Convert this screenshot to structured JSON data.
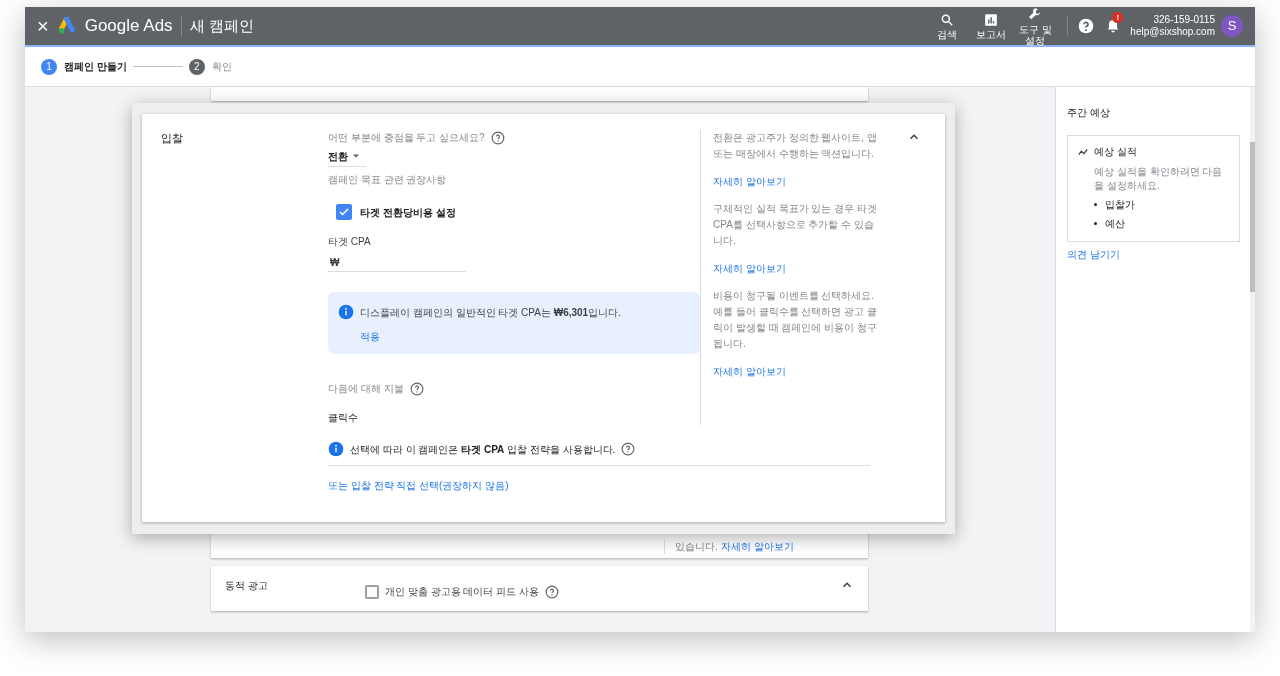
{
  "header": {
    "close": "×",
    "brand": "Google Ads",
    "page_title": "새 캠페인",
    "tools": [
      {
        "kind": "search",
        "label": "검색"
      },
      {
        "kind": "reports",
        "label": "보고서"
      },
      {
        "kind": "tools",
        "label": "도구 및 설정"
      }
    ],
    "account": {
      "phone": "326-159-0115",
      "email": "help@sixshop.com",
      "avatar": "S"
    },
    "notification_badge": "!"
  },
  "steps": [
    {
      "number": "1",
      "label": "캠페인 만들기",
      "selected": true
    },
    {
      "number": "2",
      "label": "확인",
      "selected": false
    }
  ],
  "bidding": {
    "title": "입찰",
    "question": "어떤 부분에 중점을 두고 싶으세요?",
    "focus": "전환",
    "recommendation": "캠페인 목표 관련 권장사항",
    "target_cpa_checkbox": {
      "label": "타겟 전환당비용 설정",
      "checked": true
    },
    "target_cpa_label": "타겟 CPA",
    "currency": "₩",
    "info": {
      "text": "디스플레이 캠페인의 일반적인 타겟 CPA는 **₩6,301**입니다.",
      "action": "적용"
    },
    "pay_for_label": "다음에 대해 지불",
    "pay_for": "클릭수",
    "strategy_note": "선택에 따라 이 캠페인은 **타겟 CPA** 입찰 전략을 사용합니다.",
    "manual_link": "또는 입찰 전략 직접 선택(권장하지 않음)",
    "help": [
      {
        "text": "전환은 광고주가 정의한 웹사이트, 앱 또는 매장에서 수행하는 액션입니다.",
        "link": "자세히 알아보기"
      },
      {
        "text": "구체적인 실적 목표가 있는 경우 타겟 CPA를 선택사항으로 추가할 수 있습니다.",
        "link": "자세히 알아보기"
      },
      {
        "text": "비용이 청구될 이벤트를 선택하세요. 예를 들어 클릭수를 선택하면 광고 클릭이 발생할 때 캠페인에 비용이 청구됩니다.",
        "link": "자세히 알아보기"
      }
    ]
  },
  "background_card": {
    "text": "있습니다.",
    "link": "자세히 알아보기"
  },
  "dynamic_ads": {
    "title": "동적 광고",
    "checkbox": {
      "label": "개인 맞춤 광고용 데이터 피드 사용",
      "checked": false
    }
  },
  "forecast": {
    "title": "주간 예상",
    "card_title": "예상 실적",
    "description": "예상 실적을 확인하려면 다음을 설정하세요.",
    "items": [
      "입찰가",
      "예산"
    ],
    "feedback_link": "의견 남기기"
  }
}
